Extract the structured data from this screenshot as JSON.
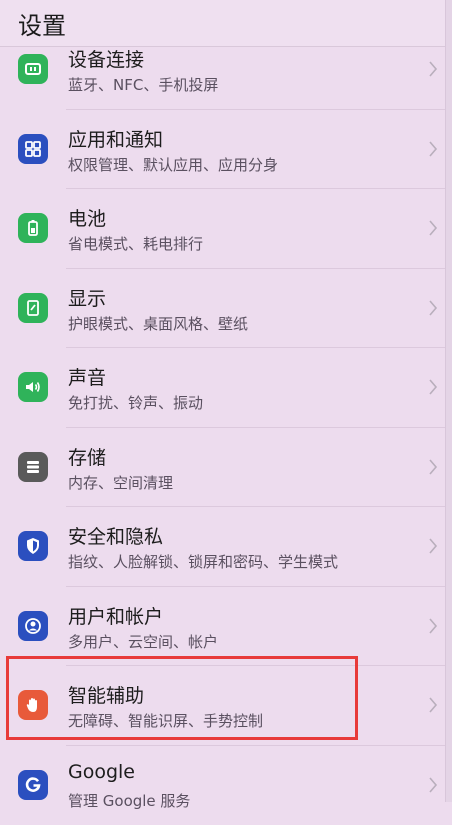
{
  "header": {
    "title": "设置"
  },
  "items": [
    {
      "title": "设备连接",
      "subtitle": "蓝牙、NFC、手机投屏",
      "icon": "device-connection-icon",
      "color": "#2fb35a"
    },
    {
      "title": "应用和通知",
      "subtitle": "权限管理、默认应用、应用分身",
      "icon": "apps-grid-icon",
      "color": "#2b4fbf"
    },
    {
      "title": "电池",
      "subtitle": "省电模式、耗电排行",
      "icon": "battery-icon",
      "color": "#2fb35a"
    },
    {
      "title": "显示",
      "subtitle": "护眼模式、桌面风格、壁纸",
      "icon": "display-icon",
      "color": "#2fb35a"
    },
    {
      "title": "声音",
      "subtitle": "免打扰、铃声、振动",
      "icon": "speaker-icon",
      "color": "#2fb35a"
    },
    {
      "title": "存储",
      "subtitle": "内存、空间清理",
      "icon": "storage-icon",
      "color": "#5a5a5a"
    },
    {
      "title": "安全和隐私",
      "subtitle": "指纹、人脸解锁、锁屏和密码、学生模式",
      "icon": "shield-icon",
      "color": "#2b4fbf"
    },
    {
      "title": "用户和帐户",
      "subtitle": "多用户、云空间、帐户",
      "icon": "user-account-icon",
      "color": "#2b4fbf"
    },
    {
      "title": "智能辅助",
      "subtitle": "无障碍、智能识屏、手势控制",
      "icon": "hand-icon",
      "color": "#e85a3a"
    },
    {
      "title": "Google",
      "subtitle": "管理 Google 服务",
      "icon": "google-icon",
      "color": "#2b4fbf"
    }
  ]
}
